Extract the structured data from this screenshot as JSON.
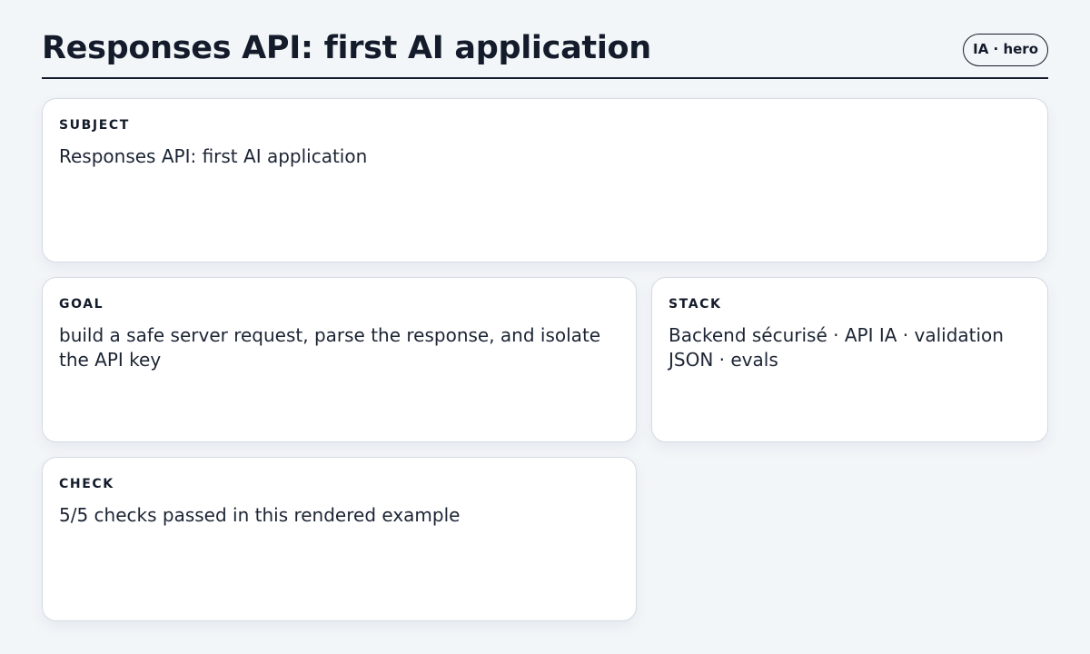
{
  "header": {
    "title": "Responses API: first AI application",
    "badge": "IA · hero"
  },
  "cards": {
    "subject": {
      "label": "SUBJECT",
      "value": "Responses API: first AI application"
    },
    "goal": {
      "label": "GOAL",
      "value": "build a safe server request, parse the response, and isolate the API key"
    },
    "stack": {
      "label": "STACK",
      "value": "Backend sécurisé · API IA · validation JSON · evals"
    },
    "check": {
      "label": "CHECK",
      "value": "5/5 checks passed in this rendered example"
    }
  }
}
